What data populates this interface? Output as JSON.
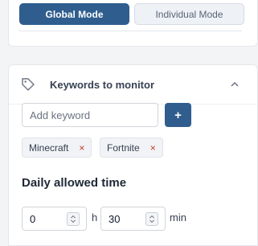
{
  "mode": {
    "global_label": "Global Mode",
    "individual_label": "Individual Mode"
  },
  "keywords": {
    "title": "Keywords to monitor",
    "input_placeholder": "Add keyword",
    "add_label": "+",
    "items": [
      "Minecraft",
      "Fortnite"
    ],
    "remove_symbol": "×"
  },
  "daily": {
    "title": "Daily allowed time",
    "hours_value": "0",
    "hours_unit": "h",
    "minutes_value": "30",
    "minutes_unit": "min"
  },
  "colors": {
    "accent": "#2f5d8e",
    "remove": "#c0392b"
  }
}
